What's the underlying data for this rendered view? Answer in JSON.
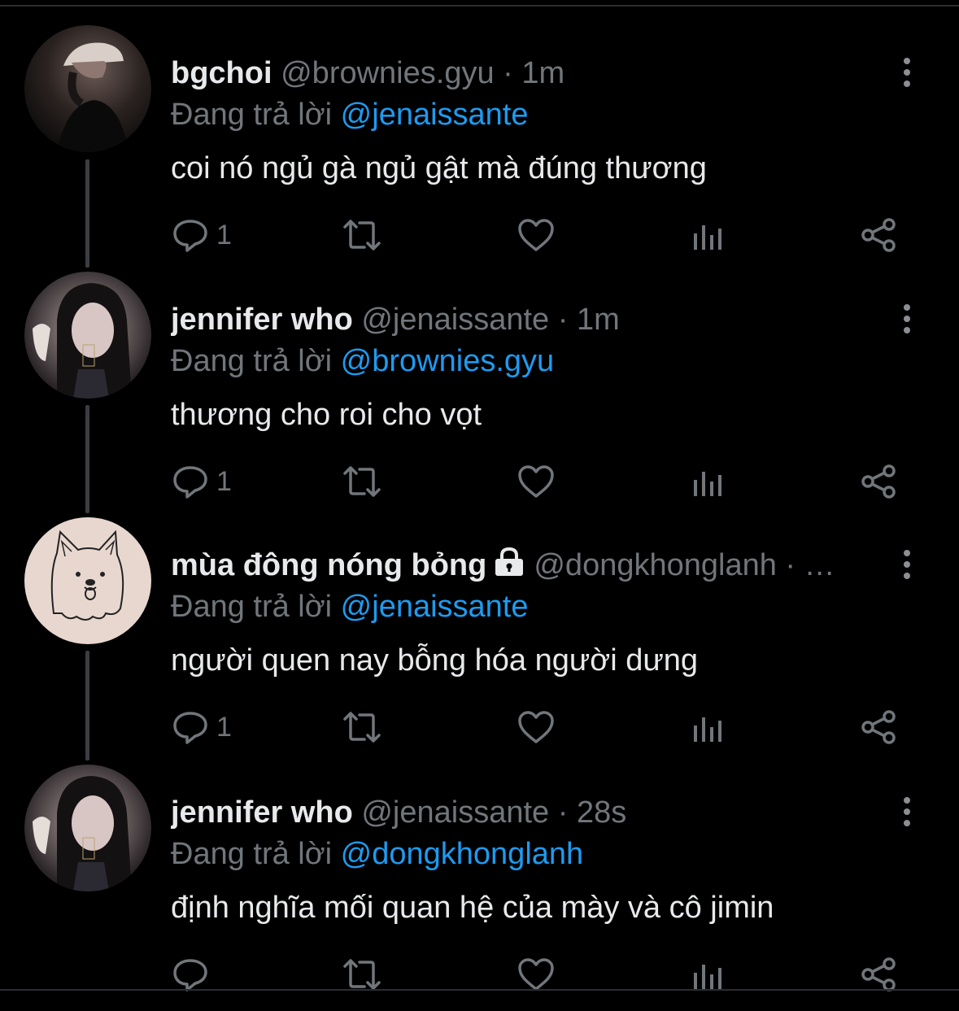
{
  "tweets": [
    {
      "name": "bgchoi",
      "handle": "@brownies.gyu",
      "meta": "· 1m",
      "reply_prefix": "Đang trả lời",
      "reply_to": "@jenaissante",
      "text": "coi nó ngủ gà ngủ gật mà đúng thương",
      "reply_count": "1",
      "locked": false
    },
    {
      "name": "jennifer who",
      "handle": "@jenaissante",
      "meta": "· 1m",
      "reply_prefix": "Đang trả lời",
      "reply_to": "@brownies.gyu",
      "text": "thương cho roi cho vọt",
      "reply_count": "1",
      "locked": false
    },
    {
      "name": "mùa đông nóng bỏng",
      "handle": "@dongkhonglanh",
      "meta": "· …",
      "reply_prefix": "Đang trả lời",
      "reply_to": "@jenaissante",
      "text": "người quen nay bỗng hóa người dưng",
      "reply_count": "1",
      "locked": true
    },
    {
      "name": "jennifer who",
      "handle": "@jenaissante",
      "meta": "· 28s",
      "reply_prefix": "Đang trả lời",
      "reply_to": "@dongkhonglanh",
      "text": "định nghĩa mối quan hệ của mày và cô jimin",
      "reply_count": "",
      "locked": false
    }
  ],
  "icons": {
    "reply": "reply-icon",
    "retweet": "retweet-icon",
    "like": "heart-icon",
    "views": "views-icon",
    "share": "share-icon",
    "more": "more-vertical-icon",
    "lock": "lock-icon"
  },
  "colors": {
    "background": "#000000",
    "text": "#e7e9ea",
    "muted": "#71767b",
    "link": "#1d9bf0",
    "thread_line": "#3a3d41"
  }
}
